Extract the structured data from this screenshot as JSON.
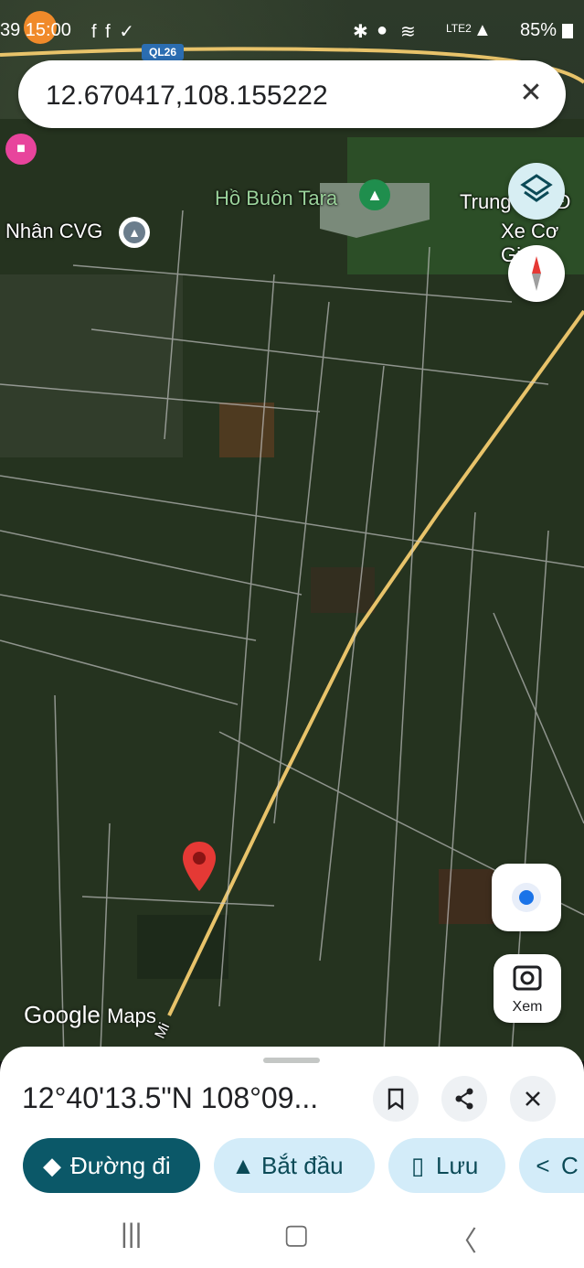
{
  "status_bar": {
    "time": "39 15:00",
    "icons_left": "f f ✓",
    "battery": "85%",
    "signal_label": "LTE2"
  },
  "road_badge": "QL26",
  "search": {
    "value": "12.670417,108.155222"
  },
  "map_labels": {
    "lake": "Hồ Buôn Tara",
    "school": "Nhân CVG",
    "center_line1": "Trung tâm Đ",
    "center_line2": "Xe Cơ Gi",
    "road": "Mi"
  },
  "xem_label": "Xem",
  "logo": {
    "google": "Google",
    "maps": "Maps"
  },
  "sheet": {
    "coordinates": "12°40'13.5\"N 108°09...",
    "chips": [
      {
        "label": "Đường đi",
        "icon": "directions-icon"
      },
      {
        "label": "Bắt đầu",
        "icon": "navigation-arrow-icon"
      },
      {
        "label": "Lưu",
        "icon": "bookmark-icon"
      },
      {
        "label": "C",
        "icon": "share-icon"
      }
    ]
  },
  "colors": {
    "primary_chip": "#0b5868",
    "chip": "#d3ecf9",
    "pin": "#e53935",
    "road": "#e8c36a"
  }
}
